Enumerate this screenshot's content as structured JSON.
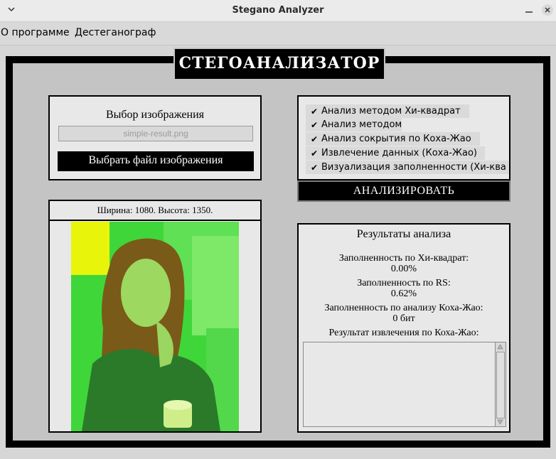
{
  "window": {
    "title": "Stegano Analyzer"
  },
  "menu": {
    "items": [
      "О программе",
      "Дестеганограф"
    ]
  },
  "header": {
    "title": "СТЕГОАНАЛИЗАТОР"
  },
  "image_select": {
    "title": "Выбор изображения",
    "filename": "simple-result.png",
    "button_label": "Выбрать файл изображения"
  },
  "options": {
    "items": [
      {
        "label": "Анализ методом Хи-квадрат",
        "checked": true
      },
      {
        "label": "Анализ методом RS",
        "checked": true
      },
      {
        "label": "Анализ сокрытия по Коха-Жао",
        "checked": true
      },
      {
        "label": "Извлечение данных (Коха-Жао)",
        "checked": true
      },
      {
        "label": "Визуализация заполненности (Хи-ква",
        "checked": true
      }
    ],
    "analyze_label": "АНАЛИЗИРОВАТЬ"
  },
  "preview": {
    "dimensions": "Ширина: 1080. Высота: 1350."
  },
  "results": {
    "title": "Результаты анализа",
    "chi_label": "Заполненность по Хи-квадрат:",
    "chi_value": "0.00%",
    "rs_label": "Заполненность по RS:",
    "rs_value": "0.62%",
    "koch_label": "Заполненность по анализу Коха-Жао:",
    "koch_value": "0 бит",
    "extract_label": "Результат извлечения по Коха-Жао:",
    "extract_text": ""
  }
}
